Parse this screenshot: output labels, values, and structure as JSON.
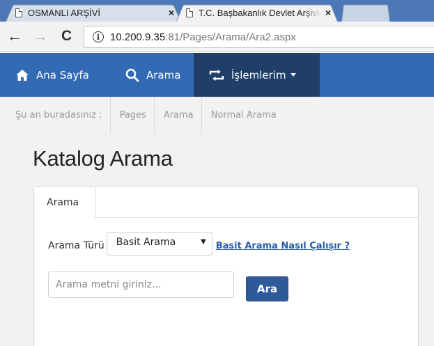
{
  "browser": {
    "tabs": [
      {
        "title": "OSMANLI ARŞİVİ",
        "close": "×"
      },
      {
        "title": "T.C. Başbakanlık Devlet Arşivleri",
        "close": "×"
      }
    ],
    "nav": {
      "back": "←",
      "forward": "→",
      "reload": "C",
      "info": "i"
    },
    "url": {
      "host": "10.200.9.35",
      "path": ":81/Pages/Arama/Ara2.aspx"
    }
  },
  "site_nav": {
    "items": [
      {
        "label": "Ana Sayfa"
      },
      {
        "label": "Arama"
      },
      {
        "label": "İşlemlerim"
      }
    ]
  },
  "breadcrumb": {
    "prefix": "Şu an buradasınız :",
    "items": [
      "Pages",
      "Arama",
      "Normal Arama"
    ]
  },
  "page": {
    "title": "Katalog Arama",
    "tab_label": "Arama",
    "search_type_label": "Arama Türü",
    "search_type_value": "Basit Arama",
    "help_link": "Basit Arama Nasıl Çalışır ?",
    "search_placeholder": "Arama metni giriniz...",
    "submit_label": "Ara"
  },
  "colors": {
    "tabstrip": "#4c77b9",
    "nav_bar": "#326ab4",
    "nav_active": "#1f3f6a",
    "button": "#2e5a9a",
    "link": "#2a5da8"
  }
}
